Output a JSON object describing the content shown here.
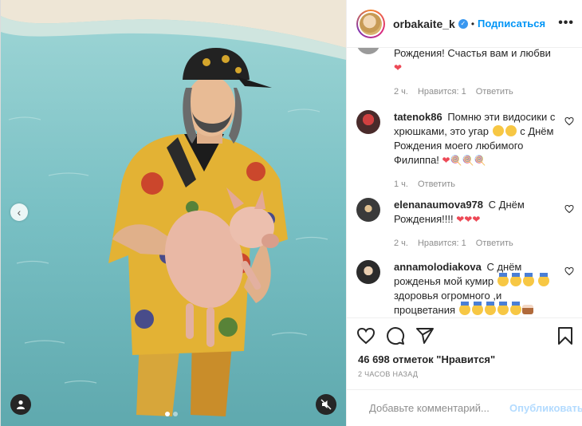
{
  "post": {
    "author": "orbakaite_k",
    "follow_label": "Подписаться",
    "sep": "•",
    "more": "•••",
    "nav_prev": "‹"
  },
  "comments": [
    {
      "user": "",
      "text": "Рождения! Счастья вам и любви",
      "time": "2 ч.",
      "likes": "Нравится: 1",
      "reply": "Ответить"
    },
    {
      "user": "tatenok86",
      "text": "Помню эти видосики с хрюшками, это угар",
      "text2": "с Днём Рождения моего любимого Филиппа!",
      "time": "1 ч.",
      "reply": "Ответить"
    },
    {
      "user": "elenanaumova978",
      "text": "С Днём Рождения!!!!",
      "time": "2 ч.",
      "likes": "Нравится: 1",
      "reply": "Ответить"
    },
    {
      "user": "annamolodiakova",
      "text": "С днём рожденья мой кумир",
      "text2": "здоровья огромного ,и процветания"
    }
  ],
  "footer": {
    "likes": "46 698 отметок \"Нравится\"",
    "time": "2 часов назад",
    "comment_placeholder": "Добавьте комментарий...",
    "publish_label": "Опубликовать"
  },
  "icons": [
    "heart-icon",
    "comment-icon",
    "share-icon",
    "bookmark-icon",
    "smile-icon",
    "user-tag-icon",
    "mute-icon",
    "verified-icon"
  ],
  "colors": {
    "accent": "#0095f6",
    "publish_disabled": "#b3dbff",
    "heart_red": "#ed4956",
    "muted": "#8e8e8e"
  }
}
